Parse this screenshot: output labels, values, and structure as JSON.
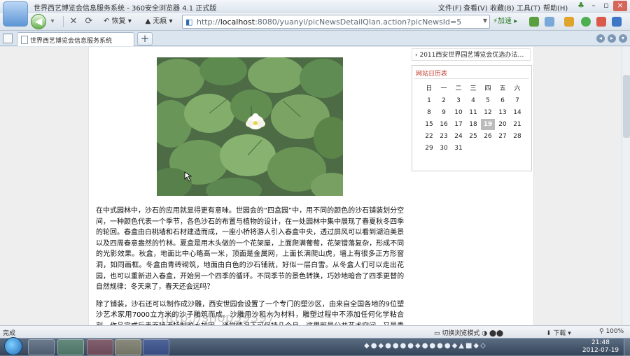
{
  "window": {
    "title": "世界西艺博览会信息服务系统 - 360安全浏览器 4.1 正式版",
    "menus": [
      "文件(F)",
      "查看(V)",
      "收藏(B)",
      "工具(T)",
      "帮助(H)"
    ],
    "logo_text": "360"
  },
  "navbar": {
    "restore_label": "恢复",
    "trace_label": "无痕",
    "address_prefix": "http://",
    "address_host": "localhost",
    "address_rest": ":8080/yuanyi/picNewsDetailQIan.action?picNewsId=5",
    "accelerate_label": "加速"
  },
  "tabs": [
    {
      "label": "世界西艺博览会信息服务系统"
    }
  ],
  "sidebar": {
    "news_item": "2011西安世界园艺博览会优选办法…",
    "calendar": {
      "title": "网站日历表",
      "weekdays": [
        "日",
        "一",
        "二",
        "三",
        "四",
        "五",
        "六"
      ],
      "weeks": [
        [
          "",
          "1",
          "2",
          "3",
          "4",
          "5",
          "6",
          "7"
        ],
        [
          "8",
          "9",
          "10",
          "11",
          "12",
          "13",
          "14"
        ],
        [
          "15",
          "16",
          "17",
          "18",
          "19",
          "20",
          "21"
        ],
        [
          "22",
          "23",
          "24",
          "25",
          "26",
          "27",
          "28"
        ],
        [
          "29",
          "30",
          "31"
        ]
      ],
      "today": "19"
    }
  },
  "article": {
    "paragraphs": [
      "在中式园林中，沙石的应用就显得更有意味。世园会的“四盒园”中，用不同的颜色的沙石铺装划分空间，一种颜色代表一个季节，各色沙石的布置与植物的设计，在一处园林中集中展现了春夏秋冬四季的轮回。春盒由白桃墙和石材建造而成，一座小桥将游人引入春盒中央，透过屏风可以看到湖泊美景以及四周春意盎然的竹林。夏盒是用木头做的一个花架屋，上面爬满葡萄，花架错落复杂，形成不同的光影效果。秋盒，地面比中心略高一米，顶面是金属网，上面长满爬山虎，墙上有很多正方形窗洞，如同画框。冬盒由青砖砌筑，地面由白色的沙石铺就，好似一层白雪。从冬盒人们可以走出花园，也可以重新进入春盒，开始另一个四季的循环。不同季节的景色转换，巧妙地暗合了四季更替的自然规律：冬天来了，春天还会远吗？",
      "除了铺装，沙石还可以制作成沙雕，西安世园会设置了一个专门的塑沙区，由来自全国各地的9位塑沙艺术家用7000立方米的沙子雕筑而成。沙雕用沙和水为材料，雕塑过程中不添加任何化学粘合剂，作品完成后表面喷洒特制胶水加固，通常情况下可保持几个月。这里既是公共艺术空间，又是青少年自娱自乐的乐园。漫步在软软的沙土上，一座座沙雕作品引人驻足欣赏，跟随设计者的思路，感受沙雕艺术独特的魅力。"
    ]
  },
  "statusbar": {
    "status": "完成",
    "mode_label": "切换浏览模式",
    "download_label": "下载",
    "zoom": "100%"
  },
  "taskbar": {
    "time": "21:48",
    "date": "2012-07-19"
  },
  "watermark": "http://shop39397"
}
